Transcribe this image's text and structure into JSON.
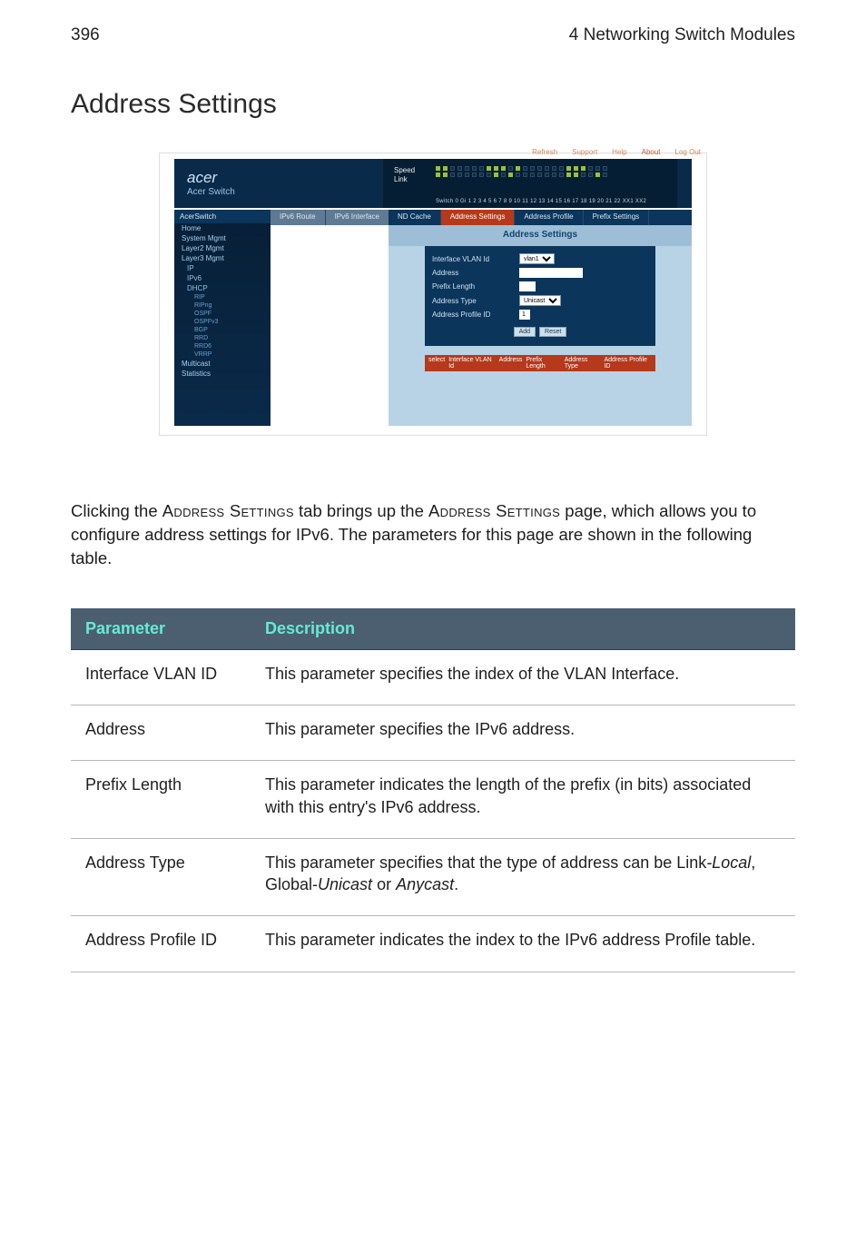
{
  "page": {
    "number": "396",
    "chapter": "4 Networking Switch Modules",
    "section_title": "Address Settings"
  },
  "screenshot": {
    "brand_name": "acer",
    "brand_sub": "Acer Switch",
    "top_links": [
      "Refresh",
      "Support",
      "Help",
      "About",
      "Log Out"
    ],
    "port_label_speed": "Speed",
    "port_label_link": "Link",
    "port_numbers": "Switch 0 Gi 1  2  3  4  5  6  7  8  9 10 11 12 13 14 15 16 17 18 19 20 21 22 XX1 XX2",
    "sidebar_title": "AcerSwitch",
    "nav_tabs": [
      "IPv6 Route",
      "IPv6 Interface"
    ],
    "sidebar_items": [
      {
        "label": "Home",
        "level": 1
      },
      {
        "label": "System Mgmt",
        "level": 1
      },
      {
        "label": "Layer2 Mgmt",
        "level": 1
      },
      {
        "label": "Layer3 Mgmt",
        "level": 1
      },
      {
        "label": "IP",
        "level": 2
      },
      {
        "label": "IPv6",
        "level": 2
      },
      {
        "label": "DHCP",
        "level": 2
      },
      {
        "label": "RIP",
        "level": 3
      },
      {
        "label": "RIPng",
        "level": 3
      },
      {
        "label": "OSPF",
        "level": 3
      },
      {
        "label": "OSPFv3",
        "level": 3
      },
      {
        "label": "BGP",
        "level": 3
      },
      {
        "label": "RRD",
        "level": 3
      },
      {
        "label": "RRD6",
        "level": 3
      },
      {
        "label": "VRRP",
        "level": 3
      },
      {
        "label": "Multicast",
        "level": 1
      },
      {
        "label": "Statistics",
        "level": 1
      }
    ],
    "tabs": [
      {
        "label": "ND Cache",
        "active": false
      },
      {
        "label": "Address Settings",
        "active": true
      },
      {
        "label": "Address Profile",
        "active": false
      },
      {
        "label": "Prefix Settings",
        "active": false
      }
    ],
    "content_title": "Address Settings",
    "form": {
      "rows": [
        {
          "label": "Interface VLAN Id",
          "control": "select",
          "value": "vlan1"
        },
        {
          "label": "Address",
          "control": "text",
          "value": ""
        },
        {
          "label": "Prefix Length",
          "control": "text-small",
          "value": ""
        },
        {
          "label": "Address Type",
          "control": "select",
          "value": "Unicast"
        },
        {
          "label": "Address Profile ID",
          "control": "text-tiny",
          "value": "1"
        }
      ],
      "buttons": [
        "Add",
        "Reset"
      ]
    },
    "table_columns": [
      "select",
      "Interface VLAN Id",
      "Address",
      "Prefix Length",
      "Address Type",
      "Address Profile ID"
    ]
  },
  "description": {
    "pre1": "Clicking the ",
    "sc1": "Address Settings",
    "mid1": " tab brings up the ",
    "sc2": "Address Settings",
    "post1": " page, which allows you to configure address settings for IPv6. The parameters for this page are shown in the following table."
  },
  "table": {
    "headers": [
      "Parameter",
      "Description"
    ],
    "rows": [
      {
        "param": "Interface VLAN ID",
        "desc": "This parameter specifies the index of the VLAN Interface."
      },
      {
        "param": "Address",
        "desc": "This parameter specifies the IPv6 address."
      },
      {
        "param": "Prefix Length",
        "desc": "This parameter indicates the length of the prefix (in bits) associated with this entry's IPv6 address."
      },
      {
        "param": "Address Type",
        "desc_pre": "This parameter specifies that the type of address can be Link",
        "desc_i1": "-Local",
        "desc_mid1": ", Global-",
        "desc_i2": "Unicast",
        "desc_mid2": " or ",
        "desc_i3": "Anycast",
        "desc_post": "."
      },
      {
        "param": "Address Profile ID",
        "desc": "This parameter indicates the index to the IPv6 address Profile table."
      }
    ]
  }
}
